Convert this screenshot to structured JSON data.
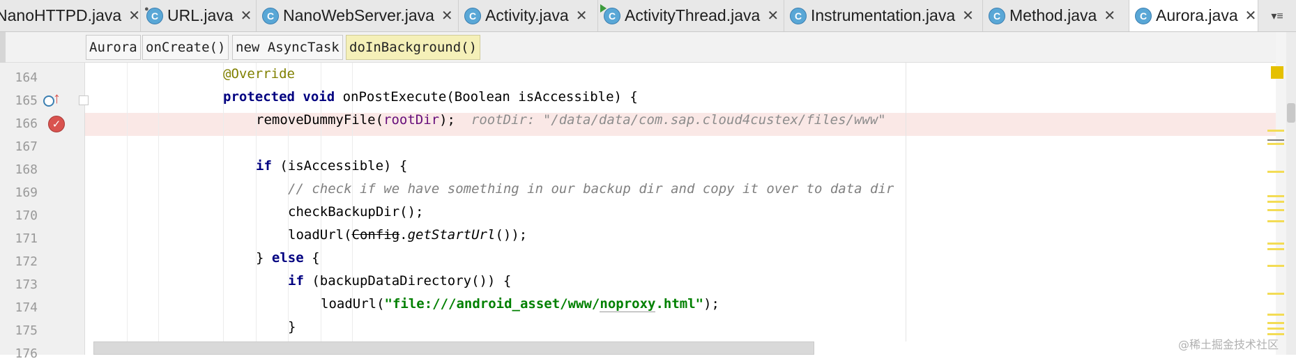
{
  "tabs": [
    {
      "label": "NanoHTTPD.java",
      "icon": "java-class-icon",
      "active": false
    },
    {
      "label": "URL.java",
      "icon": "java-class-icon",
      "active": false
    },
    {
      "label": "NanoWebServer.java",
      "icon": "java-class-icon",
      "active": false
    },
    {
      "label": "Activity.java",
      "icon": "java-class-icon",
      "active": false
    },
    {
      "label": "ActivityThread.java",
      "icon": "java-class-icon",
      "active": false
    },
    {
      "label": "Instrumentation.java",
      "icon": "java-class-icon",
      "active": false
    },
    {
      "label": "Method.java",
      "icon": "java-class-icon",
      "active": false
    },
    {
      "label": "Aurora.java",
      "icon": "java-class-icon",
      "active": true
    }
  ],
  "tab_close_glyph": "✕",
  "tab_icon_letter": "C",
  "tab_overflow_menu": "▾≡",
  "breadcrumb": [
    "Aurora",
    "onCreate()",
    "new AsyncTask",
    "doInBackground()"
  ],
  "line_numbers": [
    "164",
    "165",
    "166",
    "167",
    "168",
    "169",
    "170",
    "171",
    "172",
    "173",
    "174",
    "175",
    "176"
  ],
  "code": {
    "l164": {
      "annotation": "@Override"
    },
    "l165": {
      "kw1": "protected",
      "kw2": "void",
      "rest": " onPostExecute(Boolean isAccessible) {"
    },
    "l166": {
      "call": "removeDummyFile(",
      "arg": "rootDir",
      "end": ");",
      "hint": "rootDir: \"/data/data/com.sap.cloud4custex/files/www\""
    },
    "l168": {
      "kw": "if",
      "rest": " (isAccessible) {"
    },
    "l169": {
      "comment": "// check if we have something in our backup dir and copy it over to data dir"
    },
    "l170": {
      "text": "checkBackupDir();"
    },
    "l171": {
      "pre": "loadUrl(",
      "deprecated": "Config",
      "dot": ".",
      "method": "getStartUrl",
      "post": "());"
    },
    "l172": {
      "brace": "} ",
      "kw": "else",
      "rest": " {"
    },
    "l173": {
      "kw": "if",
      "rest": " (backupDataDirectory()) {"
    },
    "l174": {
      "pre": "loadUrl(",
      "str_a": "\"file:///android_asset/www/",
      "str_b": "noproxy",
      "str_c": ".html\"",
      "post": ");"
    },
    "l175": {
      "text": "}"
    }
  },
  "gutter_icons": {
    "breakpoint": "breakpoint-icon",
    "override": "overrides-method-icon"
  },
  "colors": {
    "keyword": "#000080",
    "annotation": "#808000",
    "field": "#660e7a",
    "string": "#008000",
    "comment": "#808080",
    "breakpoint_line": "#fae8e6",
    "breadcrumb_highlight": "#f5f0b8",
    "warning_marker": "#e5c000"
  },
  "watermark": "@稀土掘金技术社区"
}
